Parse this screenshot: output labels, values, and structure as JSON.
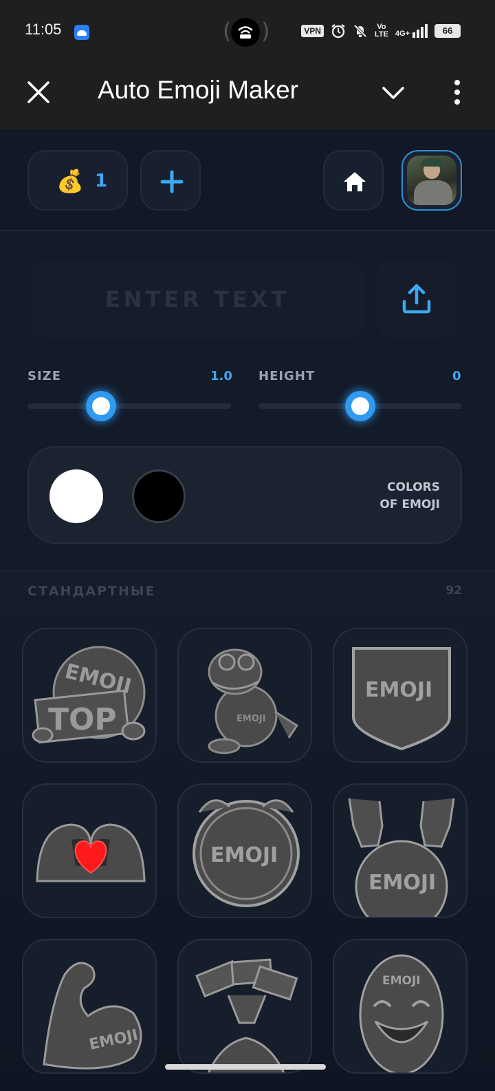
{
  "status_bar": {
    "time": "11:05",
    "vpn": "VPN",
    "volte_top": "Vo",
    "volte_bottom": "LTE",
    "network": "4G+",
    "battery": "66"
  },
  "app_bar": {
    "title": "Auto Emoji Maker"
  },
  "toolbar": {
    "coins_icon": "money-bag",
    "coins_count": "1"
  },
  "editor": {
    "text_placeholder": "ENTER TEXT",
    "size_label": "SIZE",
    "size_value": "1.0",
    "size_fraction": 0.36,
    "height_label": "HEIGHT",
    "height_value": "0",
    "height_fraction": 0.5,
    "colors_label_line1": "COLORS",
    "colors_label_line2": "OF EMOJI",
    "colors": [
      "#ffffff",
      "#000000"
    ]
  },
  "section": {
    "title": "СТАНДАРТНЫЕ",
    "count": "92"
  },
  "tiles": [
    {
      "name": "emoji-top-sign",
      "text": "EMOJI",
      "text2": "TOP"
    },
    {
      "name": "emoji-frog",
      "text": "EMOJI"
    },
    {
      "name": "emoji-shield",
      "text": "EMOJI"
    },
    {
      "name": "emoji-heart-hands",
      "text": ""
    },
    {
      "name": "emoji-round-badge",
      "text": "EMOJI"
    },
    {
      "name": "emoji-rock-hands",
      "text": "EMOJI"
    },
    {
      "name": "emoji-flex-arm",
      "text": "EMOJI"
    },
    {
      "name": "emoji-money-hand",
      "text": ""
    },
    {
      "name": "emoji-smile-mask",
      "text": "EMOJI"
    }
  ],
  "accent": "#3da8ef"
}
